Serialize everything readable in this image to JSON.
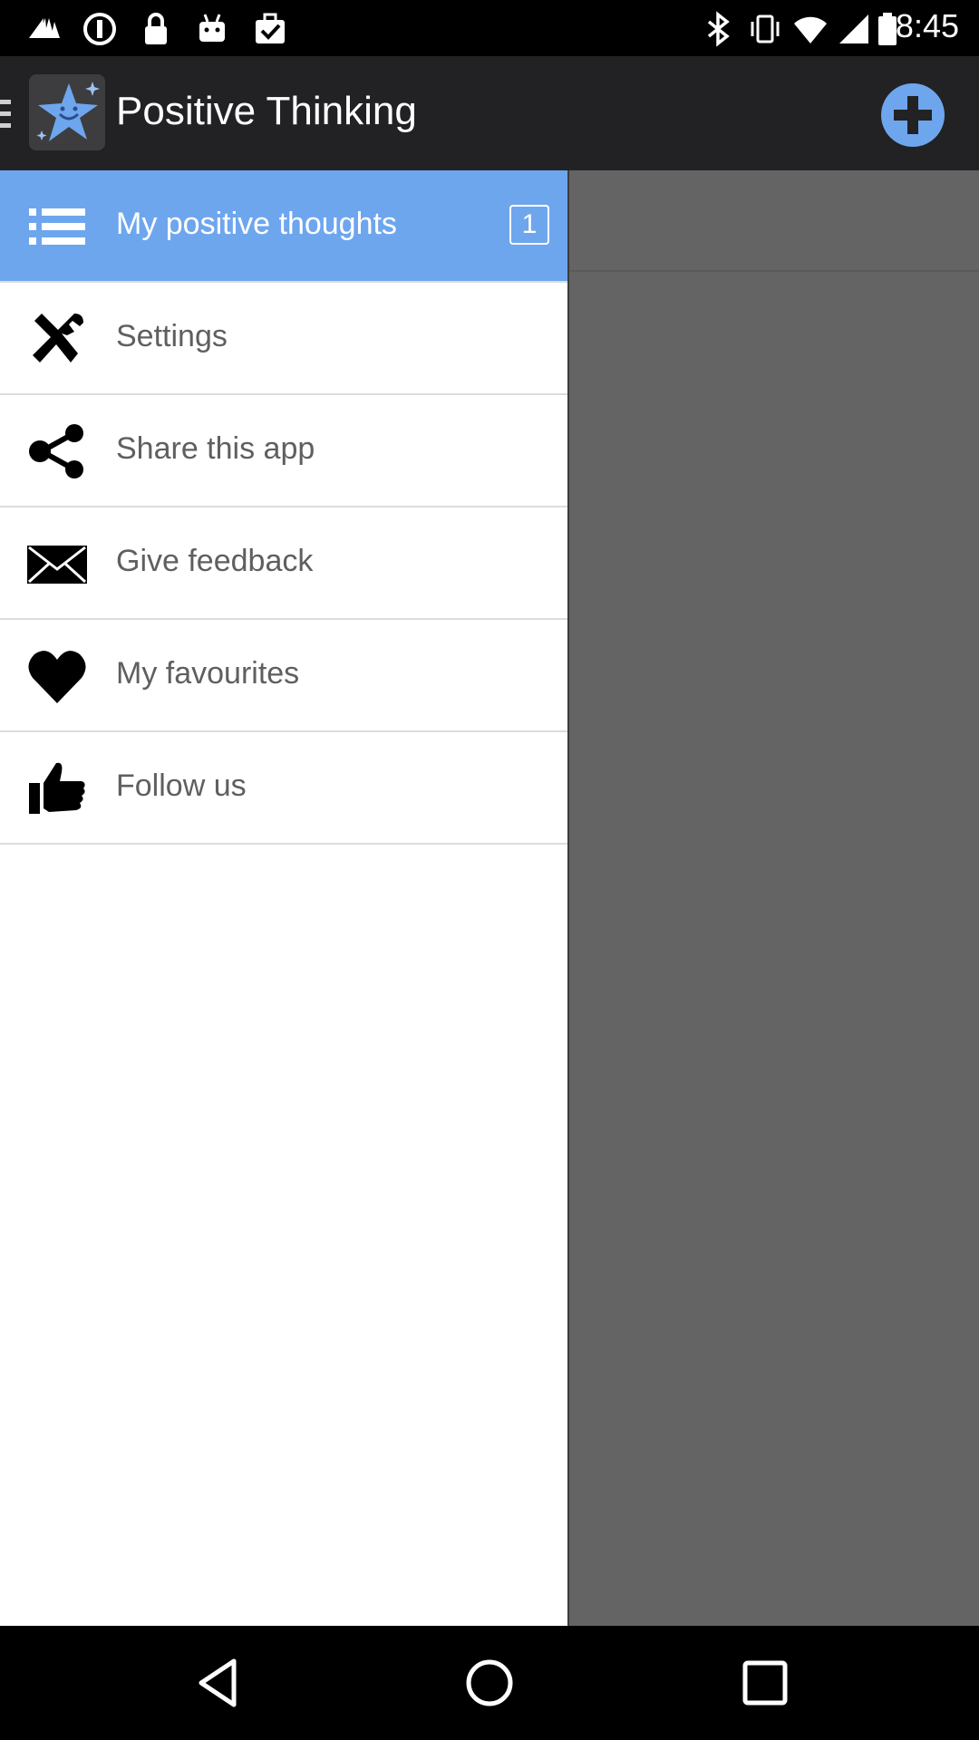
{
  "status_bar": {
    "time": "8:45",
    "icons": [
      "fan-icon",
      "circle-stop-icon",
      "lock-icon",
      "android-icon",
      "briefcase-check-icon",
      "bluetooth-icon",
      "vibrate-icon",
      "wifi-icon",
      "signal-icon",
      "battery-icon"
    ]
  },
  "action_bar": {
    "title": "Positive Thinking",
    "add_icon": "plus-circle-icon",
    "accent_color": "#6ea6ee"
  },
  "drawer": {
    "items": [
      {
        "label": "My positive thoughts",
        "icon": "list-icon",
        "badge": "1",
        "active": true
      },
      {
        "label": "Settings",
        "icon": "tools-icon"
      },
      {
        "label": "Share this app",
        "icon": "share-icon"
      },
      {
        "label": "Give feedback",
        "icon": "envelope-icon"
      },
      {
        "label": "My favourites",
        "icon": "heart-icon"
      },
      {
        "label": "Follow us",
        "icon": "thumbs-up-icon"
      }
    ]
  },
  "nav_bar": {
    "buttons": [
      "back-icon",
      "home-icon",
      "recents-icon"
    ]
  }
}
